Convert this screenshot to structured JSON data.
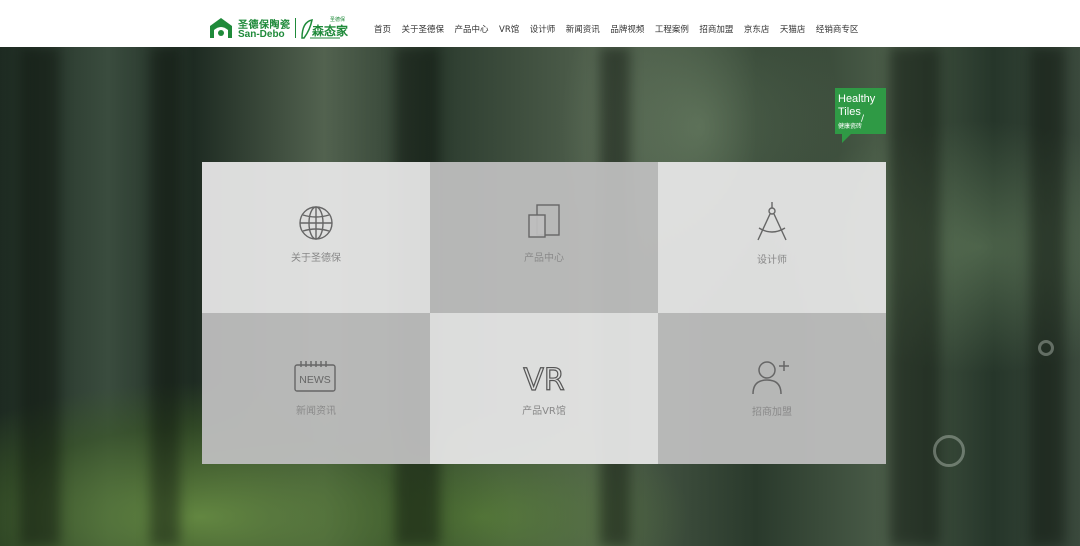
{
  "logo": {
    "brand_cn": "圣德保陶瓷",
    "brand_en": "San-Debo",
    "sub_brand": "森态家",
    "sub_tag": "圣德保"
  },
  "nav": {
    "items": [
      "首页",
      "关于圣德保",
      "产品中心",
      "VR馆",
      "设计师",
      "新闻资讯",
      "品牌视频",
      "工程案例",
      "招商加盟",
      "京东店",
      "天猫店",
      "经销商专区"
    ]
  },
  "badge": {
    "line1": "Healthy",
    "line2": "Tiles",
    "line3": "健康瓷砖"
  },
  "tiles": [
    {
      "label": "关于圣德保",
      "icon": "globe-icon"
    },
    {
      "label": "产品中心",
      "icon": "overlapping-squares-icon"
    },
    {
      "label": "设计师",
      "icon": "compass-icon"
    },
    {
      "label": "新闻资讯",
      "icon": "news-icon",
      "icon_text": "NEWS"
    },
    {
      "label": "产品VR馆",
      "icon": "vr-icon",
      "icon_text": "VR"
    },
    {
      "label": "招商加盟",
      "icon": "add-user-icon"
    }
  ],
  "colors": {
    "brand_green": "#1f8a3a",
    "badge_green": "#2f9a45",
    "tile_light": "#e6e6e6",
    "tile_mid": "#bebebe"
  }
}
